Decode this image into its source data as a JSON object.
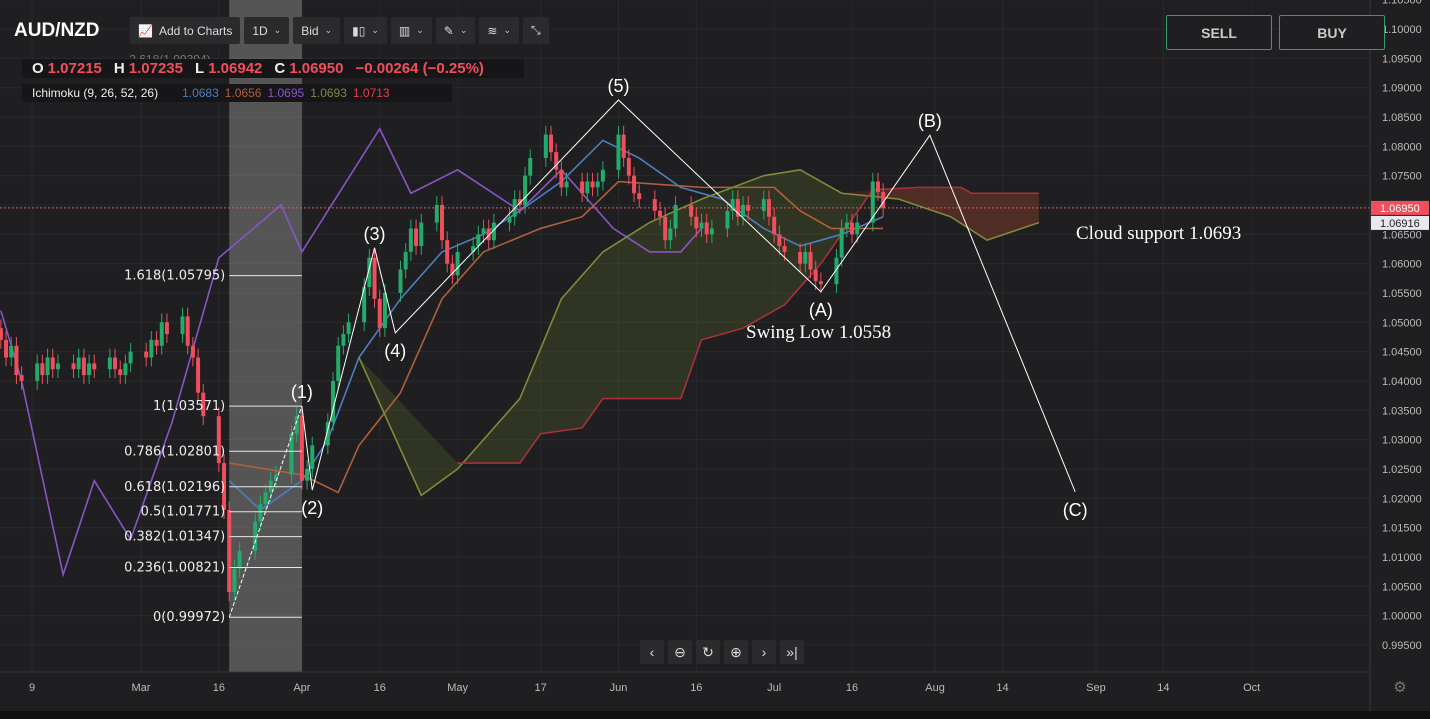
{
  "header": {
    "symbol": "AUD/NZD",
    "add_to_charts": "Add to Charts",
    "interval": "1D",
    "price_type": "Bid",
    "icons": [
      "chart-type-icon",
      "indicators-icon",
      "drawing-icon",
      "layers-icon",
      "collapse-icon"
    ]
  },
  "ohlc": {
    "o_label": "O",
    "o": "1.07215",
    "h_label": "H",
    "h": "1.07235",
    "l_label": "L",
    "l": "1.06942",
    "c_label": "C",
    "c": "1.06950",
    "change": "−0.00264 (−0.25%)"
  },
  "ichimoku": {
    "label": "Ichimoku (9, 26, 52, 26)",
    "values": [
      "1.0683",
      "1.0656",
      "1.0695",
      "1.0693",
      "1.0713"
    ],
    "colors": [
      "#4a7fc1",
      "#b0603a",
      "#8a54c8",
      "#7f8a3a",
      "#e0404a"
    ]
  },
  "trade": {
    "sell": "SELL",
    "buy": "BUY",
    "color": "#2fa062"
  },
  "nav": {
    "icons": [
      "scroll-left-icon",
      "zoom-out-icon",
      "reset-icon",
      "zoom-in-icon",
      "scroll-right-icon",
      "go-to-latest-icon"
    ]
  },
  "annotations": {
    "cloud_support": "Cloud support 1.0693",
    "swing_low": "Swing Low 1.0558"
  },
  "chart_data": {
    "type": "candlestick",
    "ylim": [
      0.993,
      1.106
    ],
    "y_ticks": [
      "1.10500",
      "1.10000",
      "1.09500",
      "1.09000",
      "1.08500",
      "1.08000",
      "1.07500",
      "1.07000",
      "1.06500",
      "1.06000",
      "1.05500",
      "1.05000",
      "1.04500",
      "1.04000",
      "1.03500",
      "1.03000",
      "1.02500",
      "1.02000",
      "1.01500",
      "1.01000",
      "1.00500",
      "1.00000",
      "0.99500"
    ],
    "x_ticks": [
      {
        "label": "9",
        "date": "2020-02-09"
      },
      {
        "label": "Mar",
        "date": "2020-03-01"
      },
      {
        "label": "16",
        "date": "2020-03-16"
      },
      {
        "label": "Apr",
        "date": "2020-04-01"
      },
      {
        "label": "16",
        "date": "2020-04-16"
      },
      {
        "label": "May",
        "date": "2020-05-01"
      },
      {
        "label": "17",
        "date": "2020-05-17"
      },
      {
        "label": "Jun",
        "date": "2020-06-01"
      },
      {
        "label": "16",
        "date": "2020-06-16"
      },
      {
        "label": "Jul",
        "date": "2020-07-01"
      },
      {
        "label": "16",
        "date": "2020-07-16"
      },
      {
        "label": "Aug",
        "date": "2020-08-01"
      },
      {
        "label": "14",
        "date": "2020-08-14"
      },
      {
        "label": "Sep",
        "date": "2020-09-01"
      },
      {
        "label": "14",
        "date": "2020-09-14"
      },
      {
        "label": "Oct",
        "date": "2020-10-01"
      }
    ],
    "last_price": {
      "value": "1.06950",
      "color": "#ef4f5c"
    },
    "cloud_price": {
      "value": "1.06916"
    },
    "candles": {
      "start": "2020-02-03",
      "up_color": "#22ab6a",
      "down_color": "#ef4f5c",
      "closes": [
        1.047,
        1.044,
        1.046,
        1.041,
        1.04,
        1.043,
        1.041,
        1.044,
        1.042,
        1.043,
        1.042,
        1.044,
        1.041,
        1.043,
        1.042,
        1.044,
        1.042,
        1.041,
        1.043,
        1.045,
        1.044,
        1.047,
        1.046,
        1.05,
        1.048,
        1.051,
        1.046,
        1.044,
        1.038,
        1.034,
        1.026,
        1.018,
        1.004,
        1.008,
        1.011,
        1.016,
        1.019,
        1.021,
        1.023,
        1.024,
        1.031,
        1.034,
        1.023,
        1.025,
        1.029,
        1.033,
        1.04,
        1.046,
        1.048,
        1.05,
        1.056,
        1.061,
        1.054,
        1.049,
        1.055,
        1.059,
        1.062,
        1.066,
        1.063,
        1.067,
        1.07,
        1.064,
        1.06,
        1.058,
        1.062,
        1.063,
        1.065,
        1.066,
        1.064,
        1.067,
        1.068,
        1.071,
        1.07,
        1.075,
        1.078,
        1.082,
        1.079,
        1.076,
        1.073,
        1.074,
        1.072,
        1.074,
        1.073,
        1.074,
        1.076,
        1.082,
        1.078,
        1.075,
        1.072,
        1.071,
        1.069,
        1.068,
        1.064,
        1.066,
        1.07,
        1.068,
        1.066,
        1.067,
        1.065,
        1.066,
        1.069,
        1.071,
        1.068,
        1.07,
        1.069,
        1.071,
        1.068,
        1.065,
        1.063,
        1.062,
        1.06,
        1.062,
        1.059,
        1.057,
        1.0565,
        1.061,
        1.066,
        1.067,
        1.065,
        1.067,
        1.074,
        1.0722,
        1.0695
      ]
    },
    "ichimoku_lines": [
      {
        "name": "tenkan",
        "color": "#4a7fc1",
        "points": [
          [
            "2020-03-18",
            1.023
          ],
          [
            "2020-03-24",
            1.018
          ],
          [
            "2020-04-01",
            1.023
          ],
          [
            "2020-04-06",
            1.03
          ],
          [
            "2020-04-12",
            1.044
          ],
          [
            "2020-04-20",
            1.054
          ],
          [
            "2020-04-28",
            1.062
          ],
          [
            "2020-05-06",
            1.065
          ],
          [
            "2020-05-13",
            1.069
          ],
          [
            "2020-05-21",
            1.074
          ],
          [
            "2020-05-29",
            1.081
          ],
          [
            "2020-06-05",
            1.078
          ],
          [
            "2020-06-13",
            1.073
          ],
          [
            "2020-06-21",
            1.071
          ],
          [
            "2020-06-29",
            1.066
          ],
          [
            "2020-07-06",
            1.063
          ],
          [
            "2020-07-14",
            1.065
          ],
          [
            "2020-07-22",
            1.068
          ]
        ]
      },
      {
        "name": "kijun",
        "color": "#b0603a",
        "points": [
          [
            "2020-03-18",
            1.026
          ],
          [
            "2020-04-01",
            1.024
          ],
          [
            "2020-04-08",
            1.021
          ],
          [
            "2020-04-12",
            1.029
          ],
          [
            "2020-04-20",
            1.038
          ],
          [
            "2020-04-28",
            1.054
          ],
          [
            "2020-05-06",
            1.062
          ],
          [
            "2020-05-17",
            1.066
          ],
          [
            "2020-05-25",
            1.068
          ],
          [
            "2020-06-01",
            1.074
          ],
          [
            "2020-06-17",
            1.073
          ],
          [
            "2020-07-01",
            1.073
          ],
          [
            "2020-07-06",
            1.069
          ],
          [
            "2020-07-12",
            1.066
          ],
          [
            "2020-07-22",
            1.066
          ]
        ]
      },
      {
        "name": "chikou",
        "color": "#8a54c8",
        "points": [
          [
            "2020-02-03",
            1.052
          ],
          [
            "2020-02-07",
            1.04
          ],
          [
            "2020-02-15",
            1.007
          ],
          [
            "2020-02-21",
            1.023
          ],
          [
            "2020-02-28",
            1.013
          ],
          [
            "2020-03-07",
            1.033
          ],
          [
            "2020-03-16",
            1.061
          ],
          [
            "2020-03-28",
            1.07
          ],
          [
            "2020-04-01",
            1.062
          ],
          [
            "2020-04-06",
            1.069
          ],
          [
            "2020-04-16",
            1.083
          ],
          [
            "2020-04-22",
            1.072
          ],
          [
            "2020-05-01",
            1.076
          ],
          [
            "2020-05-13",
            1.069
          ],
          [
            "2020-05-21",
            1.076
          ],
          [
            "2020-05-31",
            1.066
          ],
          [
            "2020-06-07",
            1.062
          ],
          [
            "2020-06-13",
            1.062
          ],
          [
            "2020-06-17",
            1.066
          ]
        ]
      },
      {
        "name": "span_a",
        "color": "#7f8a3a",
        "points": [
          [
            "2020-04-12",
            1.044
          ],
          [
            "2020-04-24",
            1.0205
          ],
          [
            "2020-05-01",
            1.025
          ],
          [
            "2020-05-13",
            1.037
          ],
          [
            "2020-05-21",
            1.054
          ],
          [
            "2020-05-29",
            1.062
          ],
          [
            "2020-06-07",
            1.067
          ],
          [
            "2020-06-17",
            1.071
          ],
          [
            "2020-06-29",
            1.075
          ],
          [
            "2020-07-06",
            1.076
          ],
          [
            "2020-07-14",
            1.072
          ],
          [
            "2020-07-25",
            1.071
          ],
          [
            "2020-08-04",
            1.068
          ],
          [
            "2020-08-11",
            1.064
          ],
          [
            "2020-08-21",
            1.067
          ]
        ]
      },
      {
        "name": "span_b",
        "color": "#a8303a",
        "points": [
          [
            "2020-05-01",
            1.026
          ],
          [
            "2020-05-13",
            1.026
          ],
          [
            "2020-05-17",
            1.031
          ],
          [
            "2020-05-25",
            1.032
          ],
          [
            "2020-05-29",
            1.037
          ],
          [
            "2020-06-13",
            1.037
          ],
          [
            "2020-06-17",
            1.047
          ],
          [
            "2020-06-25",
            1.049
          ],
          [
            "2020-07-03",
            1.053
          ],
          [
            "2020-07-10",
            1.06
          ],
          [
            "2020-07-20",
            1.0726
          ],
          [
            "2020-07-29",
            1.073
          ],
          [
            "2020-08-06",
            1.073
          ],
          [
            "2020-08-08",
            1.072
          ],
          [
            "2020-08-21",
            1.072
          ]
        ]
      }
    ],
    "fibonacci": {
      "start": "2020-03-18",
      "end": "2020-04-01",
      "levels": [
        {
          "label": "1.618(1.05795)",
          "value": 1.05795
        },
        {
          "label": "1(1.03571)",
          "value": 1.03571
        },
        {
          "label": "0.786(1.02801)",
          "value": 1.02801
        },
        {
          "label": "0.618(1.02196)",
          "value": 1.02196
        },
        {
          "label": "0.5(1.01771)",
          "value": 1.01771
        },
        {
          "label": "0.382(1.01347)",
          "value": 1.01347
        },
        {
          "label": "0.236(1.00821)",
          "value": 1.00821
        },
        {
          "label": "0(0.99972)",
          "value": 0.99972
        }
      ],
      "top_label": "2.618(1.09394)"
    },
    "waves": [
      {
        "label": "(1)",
        "date": "2020-04-01",
        "value": 1.0357,
        "pos": "above"
      },
      {
        "label": "(2)",
        "date": "2020-04-03",
        "value": 1.0214,
        "pos": "below"
      },
      {
        "label": "(3)",
        "date": "2020-04-15",
        "value": 1.0627,
        "pos": "above"
      },
      {
        "label": "(4)",
        "date": "2020-04-19",
        "value": 1.0482,
        "pos": "below"
      },
      {
        "label": "(5)",
        "date": "2020-06-01",
        "value": 1.0879,
        "pos": "above"
      },
      {
        "label": "(A)",
        "date": "2020-07-10",
        "value": 1.0552,
        "pos": "below"
      },
      {
        "label": "(B)",
        "date": "2020-07-31",
        "value": 1.0819,
        "pos": "above"
      },
      {
        "label": "(C)",
        "date": "2020-08-28",
        "value": 1.0211,
        "pos": "below"
      }
    ]
  }
}
